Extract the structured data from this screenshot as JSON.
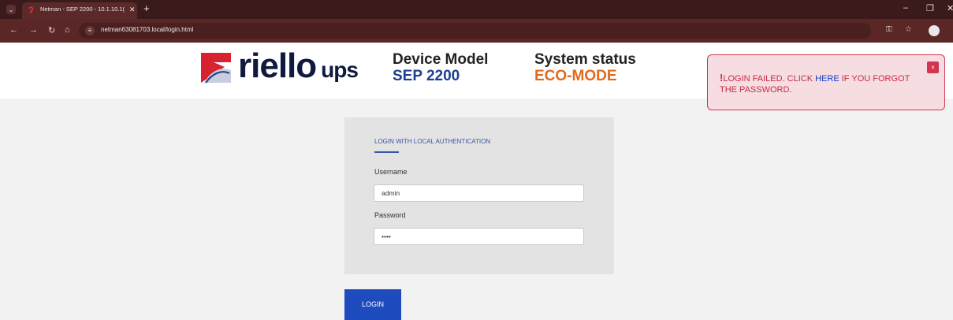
{
  "browser": {
    "tab_title": "Netman - SEP 2200 - 10.1.10.1(",
    "url": "netman63081703.local/login.html"
  },
  "header": {
    "brand_name": "riello",
    "brand_suffix": "ups",
    "device_model_label": "Device Model",
    "device_model_value": "SEP 2200",
    "system_status_label": "System status",
    "system_status_value": "ECO-MODE",
    "colors": {
      "model_value": "#1d3f8f",
      "status_value": "#e06a1d",
      "brand_red": "#d8222f",
      "brand_navy": "#0f1a3e"
    }
  },
  "alert": {
    "prefix": "LOGIN FAILED. CLICK ",
    "link": "HERE",
    "suffix": " IF YOU FORGOT THE PASSWORD.",
    "close_symbol": "×"
  },
  "login": {
    "title": "LOGIN WITH LOCAL AUTHENTICATION",
    "username_label": "Username",
    "username_value": "admin",
    "password_label": "Password",
    "password_value": "••••",
    "button_label": "LOGIN"
  },
  "icons": [
    "tab-list-icon",
    "favicon-icon",
    "close-tab-icon",
    "new-tab-icon",
    "back-icon",
    "forward-icon",
    "reload-icon",
    "home-icon",
    "site-info-icon",
    "key-icon",
    "star-icon",
    "profile-icon",
    "minimize-icon",
    "restore-icon",
    "close-window-icon"
  ]
}
